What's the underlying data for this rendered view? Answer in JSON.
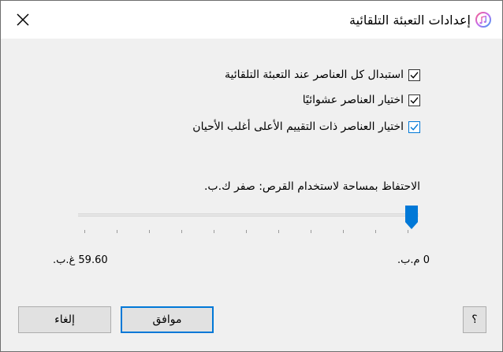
{
  "window": {
    "title": "إعدادات التعبئة التلقائية",
    "close_icon": "close-icon",
    "app_icon": "itunes-music-note-icon",
    "accent_color": "#0078d7"
  },
  "options": [
    {
      "label": "استبدال كل العناصر عند التعبئة التلقائية",
      "checked": true
    },
    {
      "label": "اختيار العناصر عشوائيًا",
      "checked": true
    },
    {
      "label": "اختيار العناصر ذات التقييم الأعلى أغلب الأحيان",
      "checked": true
    }
  ],
  "reserve": {
    "label": "الاحتفاظ بمساحة لاستخدام القرص: صفر ك.ب.",
    "slider_value_fraction": 1.0,
    "min_label": "0 م.ب.",
    "max_label": "59.60 غ.ب."
  },
  "buttons": {
    "help": "؟",
    "ok": "موافق",
    "cancel": "إلغاء"
  }
}
